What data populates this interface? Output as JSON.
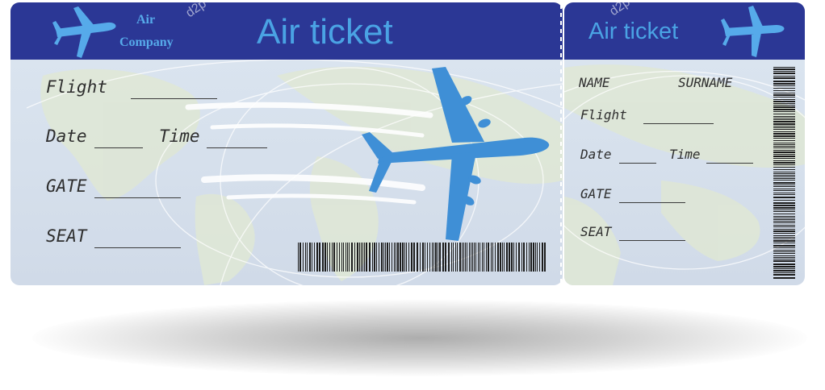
{
  "main": {
    "title": "Air ticket",
    "company_line1": "Air",
    "company_line2": "Company",
    "fields": {
      "flight": "Flight",
      "date": "Date",
      "time": "Time",
      "gate": "GATE",
      "seat": "SEAT"
    }
  },
  "stub": {
    "title": "Air ticket",
    "fields": {
      "name": "NAME",
      "surname": "SURNAME",
      "flight": "Flight",
      "date": "Date",
      "time": "Time",
      "gate": "GATE",
      "seat": "SEAT"
    }
  },
  "icons": {
    "header_plane_left": "airplane-icon",
    "header_plane_right": "airplane-icon",
    "main_plane": "airplane-icon"
  },
  "colors": {
    "header_bg": "#2b3795",
    "accent_blue": "#4aa3e4",
    "plane_blue": "#3f8fd6",
    "ticket_bg": "#dce6f1"
  },
  "watermark": "depositphotos"
}
